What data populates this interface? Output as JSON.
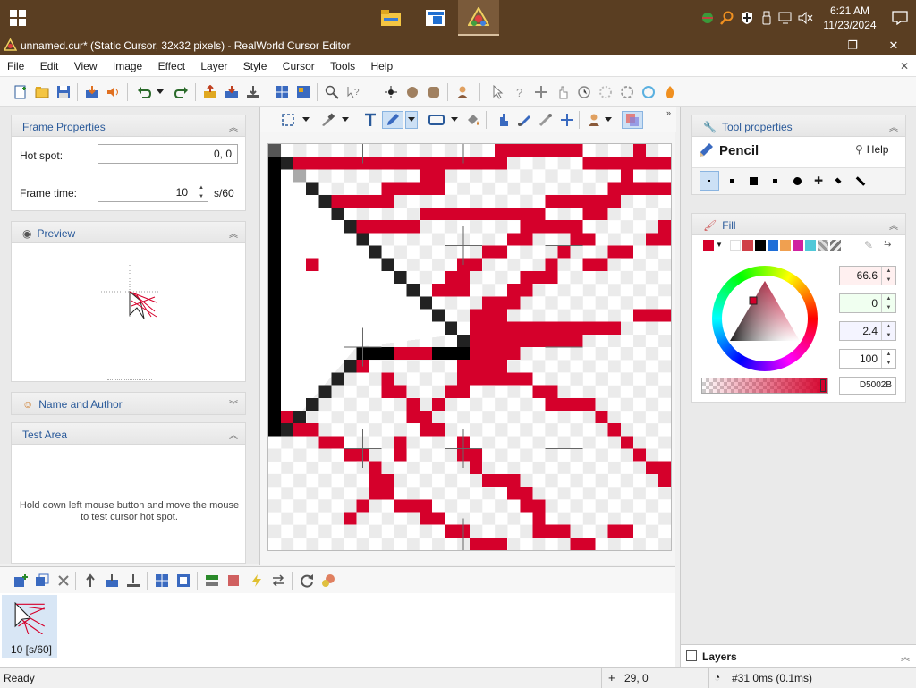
{
  "taskbar": {
    "clock_time": "6:21 AM",
    "clock_date": "11/23/2024"
  },
  "window": {
    "title": "unnamed.cur* (Static Cursor, 32x32 pixels) - RealWorld Cursor Editor"
  },
  "menu": [
    "File",
    "Edit",
    "View",
    "Image",
    "Effect",
    "Layer",
    "Style",
    "Cursor",
    "Tools",
    "Help"
  ],
  "frame_properties": {
    "title": "Frame Properties",
    "hotspot_label": "Hot spot:",
    "hotspot_value": "0, 0",
    "frametime_label": "Frame time:",
    "frametime_value": "10",
    "frametime_unit": "s/60"
  },
  "preview": {
    "title": "Preview"
  },
  "name_author": {
    "title": "Name and Author"
  },
  "test_area": {
    "title": "Test Area",
    "hint": "Hold down left mouse button and move the mouse to test cursor hot spot."
  },
  "tool_properties": {
    "title": "Tool properties",
    "tool_name": "Pencil",
    "help_label": "Help"
  },
  "fill": {
    "title": "Fill",
    "value_1": "66.6",
    "value_2": "0",
    "value_3": "2.4",
    "value_4": "100",
    "hex": "D5002B",
    "accent": "#D5002B"
  },
  "layers": {
    "title": "Layers"
  },
  "filmstrip": {
    "frame_label": "10 [s/60]"
  },
  "status": {
    "ready": "Ready",
    "coords": "29, 0",
    "frame_info": "#31 0ms (0.1ms)"
  }
}
